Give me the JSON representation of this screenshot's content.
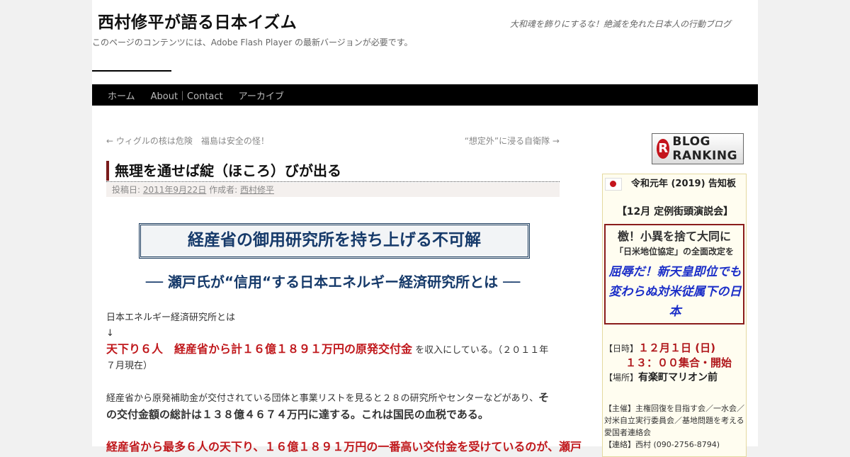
{
  "header": {
    "site_title": "西村修平が語る日本イズム",
    "tagline": "大和魂を飾りにするな！絶滅を免れた日本人の行動ブログ",
    "flash_note": "このページのコンテンツには、Adobe Flash Player の最新バージョンが必要です。"
  },
  "nav": {
    "items": [
      {
        "label": "ホーム"
      },
      {
        "label": "About｜Contact"
      },
      {
        "label": "アーカイブ"
      }
    ]
  },
  "post_nav": {
    "prev": "← ウィグルの核は危険　福島は安全の怪！",
    "next": "“想定外”に浸る自衛隊 →"
  },
  "entry": {
    "title": "無理を通せば綻（ほころ）びが出る",
    "meta_posted": "投稿日:",
    "meta_date": "2011年9月22日",
    "meta_author_label": "作成者:",
    "meta_author": "西村修平",
    "box_heading": "経産省の御用研究所を持ち上げる不可解",
    "sub_heading": "── 瀬戸氏が“信用“する日本エネルギー経済研究所とは ──",
    "p1": "日本エネルギー経済研究所とは",
    "arrow": "↓",
    "red1": "天下り６人　経産省から計１６億１８９１万円の原発交付金",
    "p2": "を収入にしている。（２０１１年７月現在）",
    "p3": "経産省から原発補助金が交付されている団体と事業リストを見ると２８の研究所やセンターなどがあり、",
    "p3_bold": "その交付金額の総計は１３８億４６７４万円に達する。これは国民の血税である。",
    "red2": "経産省から最多６人の天下り、１６億１８９１万円の一番高い交付金を受けているのが、瀬戸"
  },
  "sidebar": {
    "ranking_logo": "BLOG RANKING",
    "notice_title": "令和元年 (2019) 告知板",
    "notice_event": "【12月 定例街頭演説会】",
    "speech_line1": "檄！小異を捨て大同に",
    "speech_line2": "「日米地位協定」の全面改定を",
    "speech_line3": "屈辱だ！新天皇即位でも変わらぬ対米従属下の日本",
    "date_label": "【日時】",
    "date": "１２月１日 (日)",
    "time": "１３：００集合・開始",
    "place_label": "【場所】",
    "place": "有楽町マリオン前",
    "sponsor": "【主催】主権回復を目指す会／一水会／対米自立実行委員会／基地問題を考える愛国者連絡会",
    "contact": "【連絡】西村 (090-2756-8794)"
  }
}
